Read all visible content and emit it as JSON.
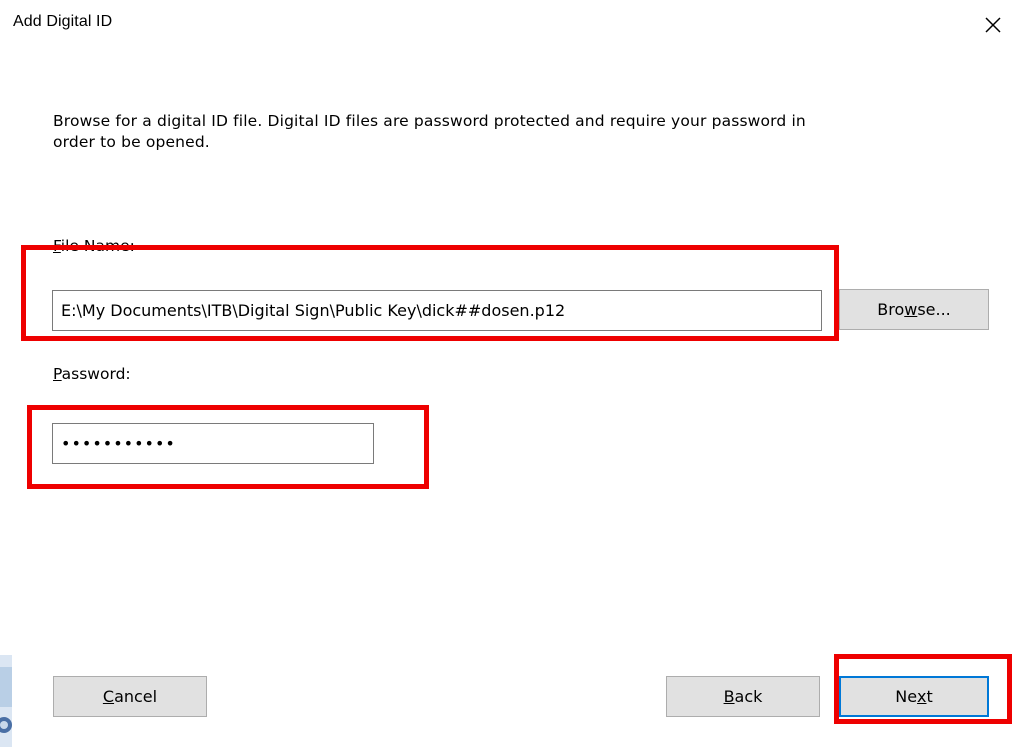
{
  "dialog": {
    "title": "Add Digital ID",
    "instructions": "Browse for a digital ID file. Digital ID files are password protected and require your password in\norder to be opened."
  },
  "file_name": {
    "label_accel": "F",
    "label_rest": "ile Name:",
    "value": "E:\\My Documents\\ITB\\Digital Sign\\Public Key\\dick##dosen.p12"
  },
  "browse_button": {
    "pre": "Bro",
    "accel": "w",
    "post": "se..."
  },
  "password": {
    "label_accel": "P",
    "label_rest": "assword:",
    "value": "•••••••••••"
  },
  "footer": {
    "cancel": {
      "pre": "",
      "accel": "C",
      "post": "ancel"
    },
    "back": {
      "pre": "",
      "accel": "B",
      "post": "ack"
    },
    "next": {
      "pre": "Ne",
      "accel": "x",
      "post": "t"
    }
  },
  "colors": {
    "highlight": "#ee0000",
    "default_button_border": "#0078d7",
    "button_face": "#e1e1e1"
  }
}
